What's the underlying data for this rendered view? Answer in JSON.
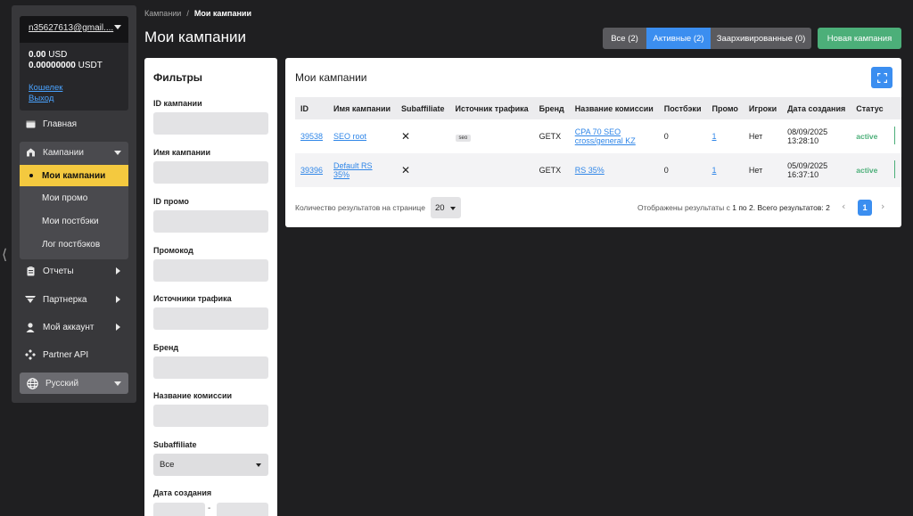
{
  "account": {
    "email": "n35627613@gmail....",
    "balance_usd_amount": "0.00",
    "balance_usd_currency": "USD",
    "balance_usdt_amount": "0.00000000",
    "balance_usdt_currency": "USDT",
    "wallet_link": "Кошелек",
    "logout_link": "Выход"
  },
  "sidebar": {
    "home": "Главная",
    "campaigns_group": {
      "label": "Кампании",
      "items": [
        "Мои кампании",
        "Мои промо",
        "Мои постбэки",
        "Лог постбэков"
      ],
      "active_index": 0
    },
    "reports": "Отчеты",
    "partnership": "Партнерка",
    "my_account": "Мой аккаунт",
    "partner_api": "Partner API",
    "language": "Русский"
  },
  "breadcrumb": {
    "parent": "Кампании",
    "separator": "/",
    "current": "Мои кампании"
  },
  "header": {
    "title": "Мои кампании",
    "tabs": {
      "all": "Все (2)",
      "active": "Активные (2)",
      "archived": "Заархивированные (0)"
    },
    "new_campaign_button": "Новая кампания"
  },
  "filters": {
    "title": "Фильтры",
    "campaign_id_label": "ID кампании",
    "campaign_name_label": "Имя кампании",
    "promo_id_label": "ID промо",
    "promocode_label": "Промокод",
    "traffic_sources_label": "Источники трафика",
    "brand_label": "Бренд",
    "commission_name_label": "Название комиссии",
    "subaffiliate_label": "Subaffiliate",
    "subaffiliate_value": "Все",
    "created_date_label": "Дата создания",
    "date_separator": "-"
  },
  "campaigns": {
    "title": "Мои кампании",
    "columns": [
      "ID",
      "Имя кампании",
      "Subaffiliate",
      "Источник трафика",
      "Бренд",
      "Название комиссии",
      "Постбэки",
      "Промо",
      "Игроки",
      "Дата создания",
      "Статус"
    ],
    "rows": [
      {
        "id": "39538",
        "name_line1": "SEO root",
        "name_line2": "",
        "subaffiliate": "✕",
        "traffic_source": "seo",
        "brand": "GETX",
        "commission_line1": "CPA 70 SEO",
        "commission_line2": "cross/general KZ",
        "postbacks": "0",
        "promo": "1",
        "players": "Нет",
        "created": "08/09/2025 13:28:10",
        "status": "active"
      },
      {
        "id": "39396",
        "name_line1": "Default RS",
        "name_line2": "35%",
        "subaffiliate": "✕",
        "traffic_source": "",
        "brand": "GETX",
        "commission_line1": "RS 35%",
        "commission_line2": "",
        "postbacks": "0",
        "promo": "1",
        "players": "Нет",
        "created": "05/09/2025 16:37:10",
        "status": "active"
      }
    ],
    "per_page_label": "Количество результатов на странице",
    "per_page_value": "20",
    "results_prefix": "Отображены результаты с",
    "results_range": "1 по 2. Всего результатов: 2",
    "current_page": "1",
    "prev": "‹",
    "next": "›"
  },
  "colors": {
    "accent_blue": "#3b8ef0",
    "active_yellow": "#f4c93f",
    "success_green": "#4caf79",
    "sidebar_bg": "#38383b",
    "page_bg": "#1f1f21"
  },
  "icons": [
    "home-icon",
    "campaigns-icon",
    "reports-icon",
    "partnership-icon",
    "account-icon",
    "api-icon",
    "globe-icon",
    "fullscreen-icon"
  ]
}
